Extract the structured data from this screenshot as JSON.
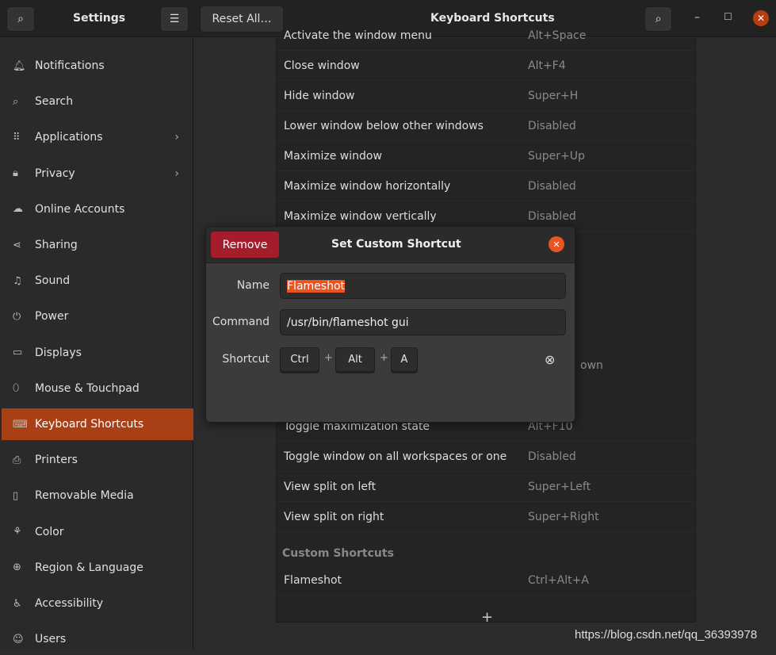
{
  "header": {
    "settings_title": "Settings",
    "reset_label": "Reset All…",
    "page_title": "Keyboard Shortcuts"
  },
  "sidebar": {
    "items": [
      {
        "label": "Notifications",
        "icon": "bell-icon"
      },
      {
        "label": "Search",
        "icon": "search-icon"
      },
      {
        "label": "Applications",
        "icon": "grid-icon",
        "chevron": true
      },
      {
        "label": "Privacy",
        "icon": "lock-icon",
        "chevron": true
      },
      {
        "label": "Online Accounts",
        "icon": "cloud-icon"
      },
      {
        "label": "Sharing",
        "icon": "share-icon"
      },
      {
        "label": "Sound",
        "icon": "music-icon"
      },
      {
        "label": "Power",
        "icon": "power-icon"
      },
      {
        "label": "Displays",
        "icon": "display-icon"
      },
      {
        "label": "Mouse & Touchpad",
        "icon": "mouse-icon"
      },
      {
        "label": "Keyboard Shortcuts",
        "icon": "keyboard-icon",
        "active": true
      },
      {
        "label": "Printers",
        "icon": "printer-icon"
      },
      {
        "label": "Removable Media",
        "icon": "usb-icon"
      },
      {
        "label": "Color",
        "icon": "color-icon"
      },
      {
        "label": "Region & Language",
        "icon": "globe-icon"
      },
      {
        "label": "Accessibility",
        "icon": "accessibility-icon"
      },
      {
        "label": "Users",
        "icon": "users-icon"
      }
    ]
  },
  "shortcuts": {
    "rows": [
      {
        "name": "Activate the window menu",
        "accel": "Alt+Space"
      },
      {
        "name": "Close window",
        "accel": "Alt+F4"
      },
      {
        "name": "Hide window",
        "accel": "Super+H"
      },
      {
        "name": "Lower window below other windows",
        "accel": "Disabled"
      },
      {
        "name": "Maximize window",
        "accel": "Super+Up"
      },
      {
        "name": "Maximize window horizontally",
        "accel": "Disabled"
      },
      {
        "name": "Maximize window vertically",
        "accel": "Disabled"
      }
    ],
    "partial_text": "own",
    "rows_after": [
      {
        "name": "Toggle maximization state",
        "accel": "Alt+F10"
      },
      {
        "name": "Toggle window on all workspaces or one",
        "accel": "Disabled"
      },
      {
        "name": "View split on left",
        "accel": "Super+Left"
      },
      {
        "name": "View split on right",
        "accel": "Super+Right"
      }
    ],
    "custom_section": "Custom Shortcuts",
    "custom": [
      {
        "name": "Flameshot",
        "accel": "Ctrl+Alt+A"
      }
    ],
    "add_label": "+"
  },
  "dialog": {
    "remove_label": "Remove",
    "title": "Set Custom Shortcut",
    "name_label": "Name",
    "name_value": "Flameshot",
    "command_label": "Command",
    "command_value": "/usr/bin/flameshot gui",
    "shortcut_label": "Shortcut",
    "keys": [
      "Ctrl",
      "Alt",
      "A"
    ],
    "key_sep": "+"
  },
  "watermark": "https://blog.csdn.net/qq_36393978",
  "colors": {
    "accent": "#a93f15",
    "remove": "#a51d2d",
    "close": "#e95420",
    "selection": "#e95420"
  }
}
